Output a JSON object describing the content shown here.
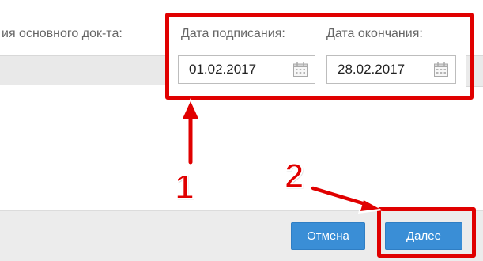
{
  "form": {
    "main_doc_label": "ия основного док-та:",
    "sign_date_label": "Дата подписания:",
    "end_date_label": "Дата окончания:",
    "sign_date_value": "01.02.2017",
    "end_date_value": "28.02.2017"
  },
  "footer": {
    "cancel_label": "Отмена",
    "next_label": "Далее"
  },
  "annotations": {
    "step1": "1",
    "step2": "2",
    "highlight_color": "#e00000"
  },
  "icons": {
    "calendar": "calendar-icon"
  },
  "colors": {
    "button_blue": "#3a8ed6",
    "footer_bg": "#ececec"
  }
}
